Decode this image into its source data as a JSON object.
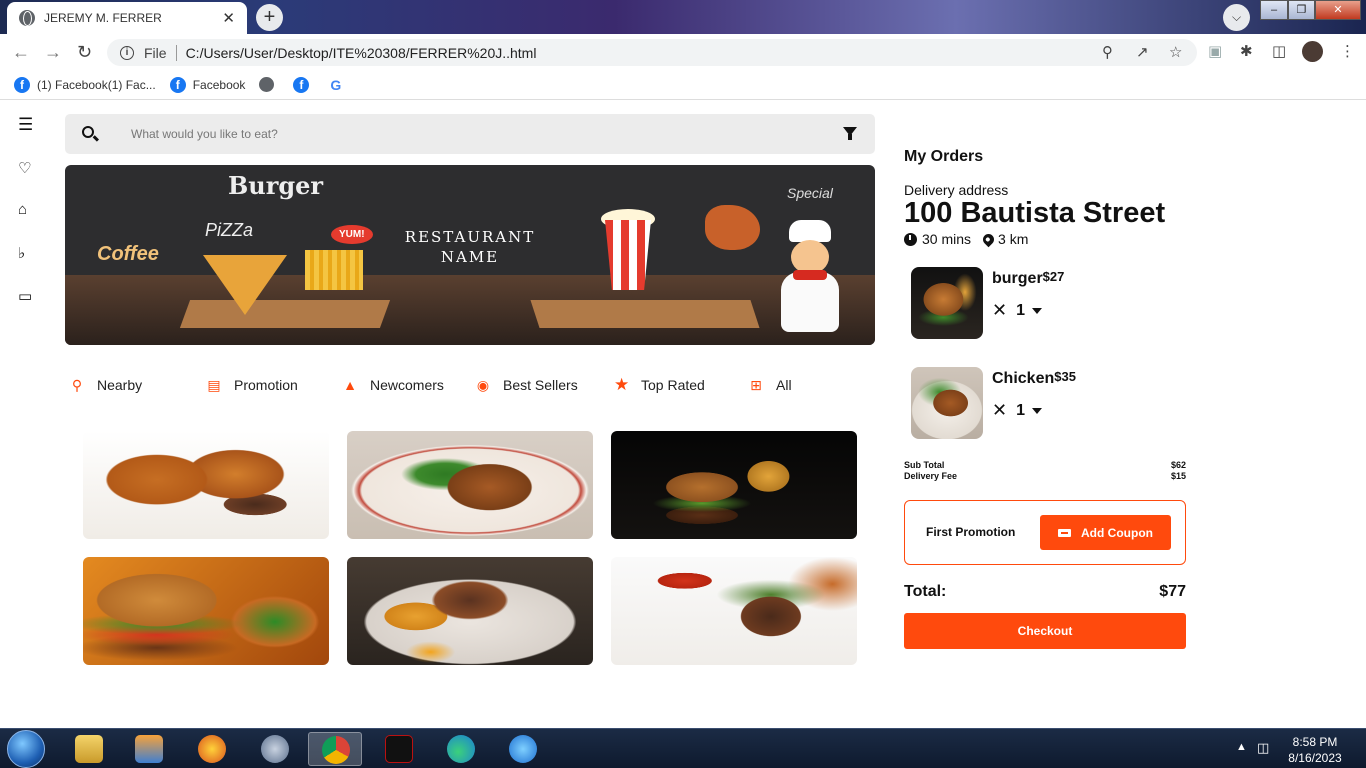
{
  "browser": {
    "tab_title": "JEREMY M. FERRER",
    "tab_close": "✕",
    "new_tab": "+",
    "address_scheme": "File",
    "address_url": "C:/Users/User/Desktop/ITE%20308/FERRER%20J..html",
    "bookmarks": [
      {
        "label": "(1) Facebook(1) Fac...",
        "icon": "facebook-icon"
      },
      {
        "label": "Facebook",
        "icon": "facebook-icon"
      },
      {
        "label": "",
        "icon": "globe-icon"
      },
      {
        "label": "",
        "icon": "facebook-icon"
      },
      {
        "label": "G",
        "icon": "google-icon"
      }
    ]
  },
  "search": {
    "placeholder": "What would you like to eat?"
  },
  "banner": {
    "title_line1": "RESTAURANT",
    "title_line2": "NAME",
    "burger": "Burger",
    "pizza": "PiZZa",
    "special": "Special",
    "coffee": "Coffee",
    "yum": "YUM!"
  },
  "categories": [
    {
      "label": "Nearby",
      "icon": "location-pin-icon"
    },
    {
      "label": "Promotion",
      "icon": "ticket-icon"
    },
    {
      "label": "Newcomers",
      "icon": "cloche-icon"
    },
    {
      "label": "Best Sellers",
      "icon": "award-icon"
    },
    {
      "label": "Top Rated",
      "icon": "star-icon"
    },
    {
      "label": "All",
      "icon": "grid-icon"
    }
  ],
  "orders": {
    "heading": "My Orders",
    "address_label": "Delivery address",
    "address": "100 Bautista Street",
    "time": "30 mins",
    "distance": "3 km",
    "items": [
      {
        "name": "burger",
        "price": "$27",
        "qty": "1"
      },
      {
        "name": "Chicken",
        "price": "$35",
        "qty": "1"
      }
    ],
    "subtotal_label": "Sub Total",
    "subtotal": "$62",
    "delivery_label": "Delivery Fee",
    "delivery": "$15",
    "promo_label": "First Promotion",
    "coupon_button": "Add Coupon",
    "total_label": "Total:",
    "total": "$77",
    "checkout": "Checkout"
  },
  "taskbar": {
    "time": "8:58 PM",
    "date": "8/16/2023"
  },
  "colors": {
    "accent": "#ff4a0d"
  }
}
